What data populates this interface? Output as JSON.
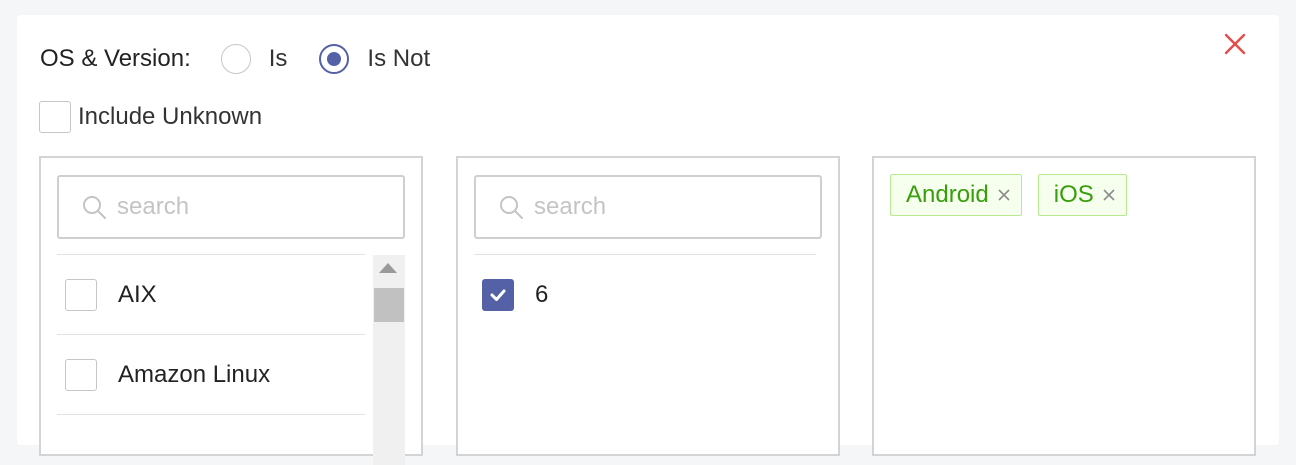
{
  "filter": {
    "label": "OS & Version:",
    "options": [
      {
        "label": "Is",
        "selected": false
      },
      {
        "label": "Is Not",
        "selected": true
      }
    ],
    "include_unknown": {
      "label": "Include Unknown",
      "checked": false
    }
  },
  "os_panel": {
    "search_placeholder": "search",
    "items": [
      {
        "label": "AIX",
        "checked": false
      },
      {
        "label": "Amazon Linux",
        "checked": false
      }
    ]
  },
  "version_panel": {
    "search_placeholder": "search",
    "items": [
      {
        "label": "6",
        "checked": true
      }
    ]
  },
  "selected_panel": {
    "tags": [
      {
        "label": "Android"
      },
      {
        "label": "iOS"
      }
    ]
  },
  "colors": {
    "accent": "#5561a6",
    "close": "#e84b4b",
    "tag_text": "#389e0d",
    "tag_bg": "#f6ffed",
    "tag_border": "#b7eb8f"
  }
}
